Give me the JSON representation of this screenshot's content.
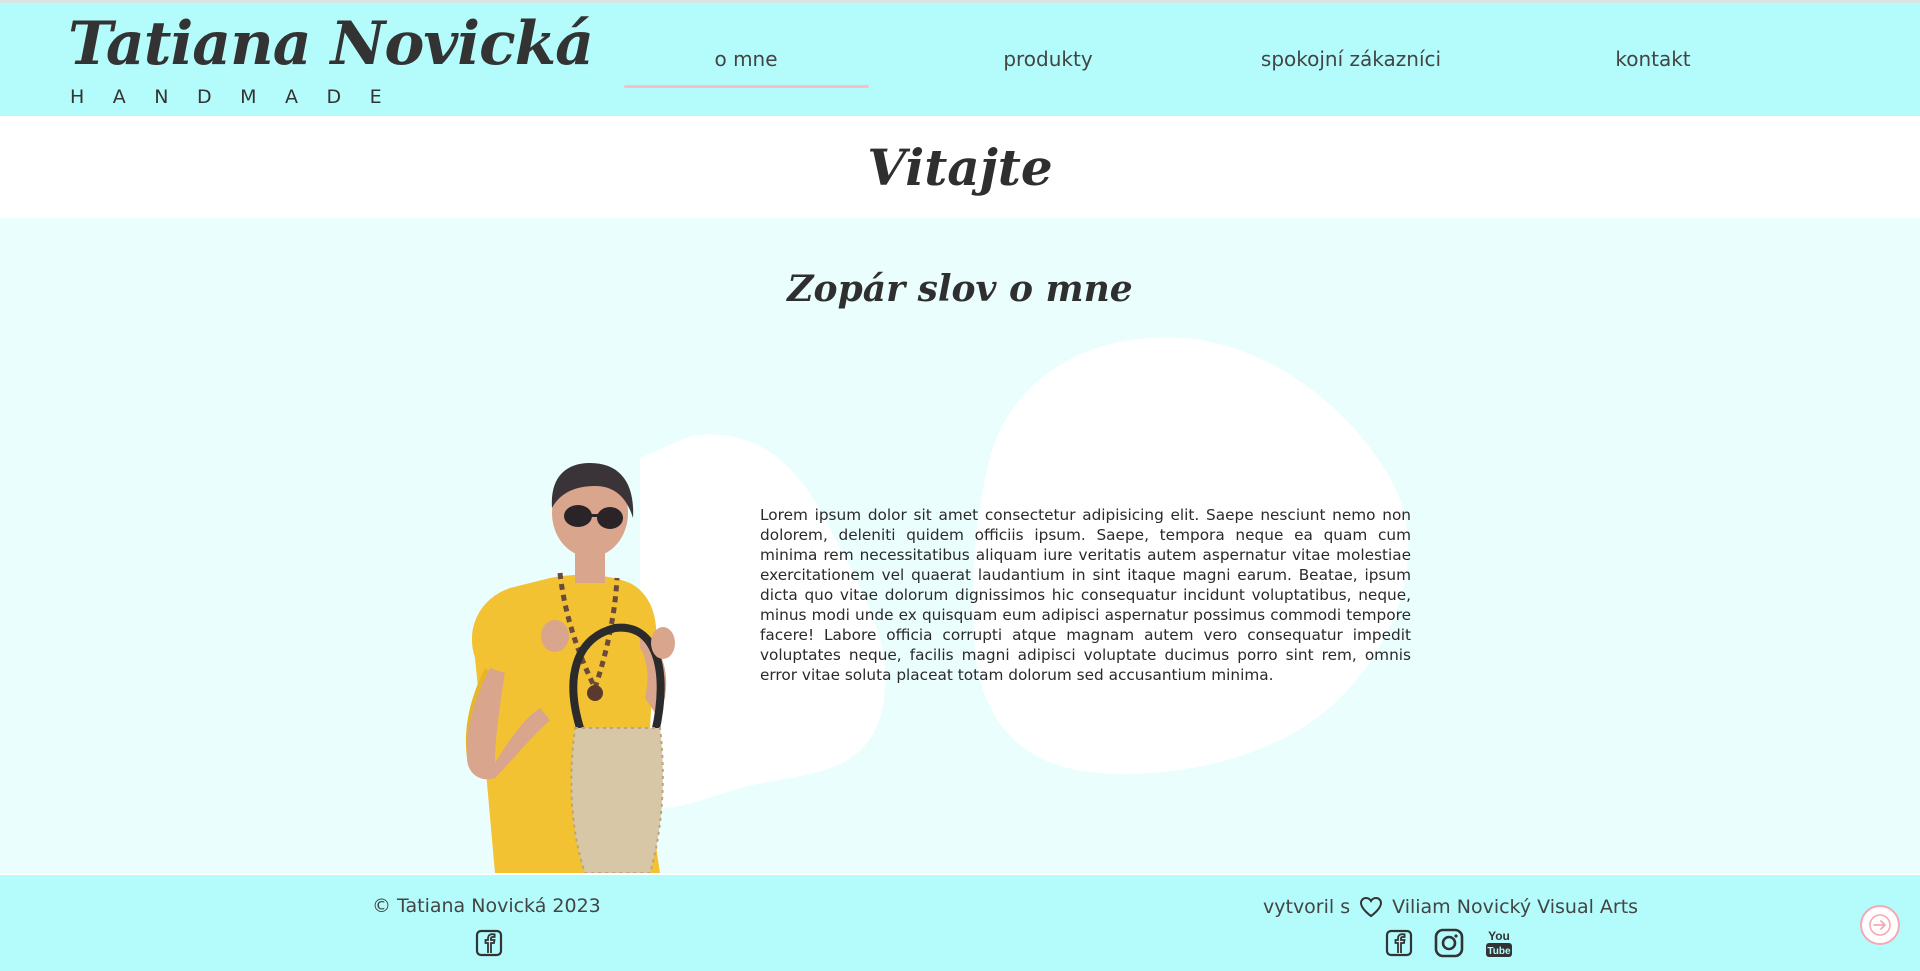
{
  "header": {
    "logo_name": "Tatiana Novická",
    "logo_sub": "HANDMADE",
    "nav": [
      {
        "label": "o mne",
        "active": true
      },
      {
        "label": "produkty"
      },
      {
        "label": "spokojní zákazníci"
      },
      {
        "label": "kontakt"
      }
    ]
  },
  "welcome": {
    "title": "Vitajte"
  },
  "about": {
    "title": "Zopár slov o mne",
    "text": "Lorem ipsum dolor sit amet consectetur adipisicing elit. Saepe nesciunt nemo non dolorem, deleniti quidem officiis ipsum. Saepe, tempora neque ea quam cum minima rem necessitatibus aliquam iure veritatis autem aspernatur vitae molestiae exercitationem vel quaerat laudantium in sint itaque magni earum. Beatae, ipsum dicta quo vitae dolorum dignissimos hic consequatur incidunt voluptatibus, neque, minus modi unde ex quisquam eum adipisci aspernatur possimus commodi tempore facere! Labore officia corrupti atque magnam autem vero consequatur impedit voluptates neque, facilis magni adipisci voluptate ducimus porro sint rem, omnis error vitae soluta placeat totam dolorum sed accusantium minima."
  },
  "footer": {
    "copyright": "© Tatiana Novická 2023",
    "credit_prefix": "vytvoril s",
    "credit_name": "Viliam Novický Visual Arts",
    "social_icons": [
      "facebook-icon",
      "instagram-icon",
      "youtube-icon"
    ]
  },
  "colors": {
    "header_bg": "#b4fcfc",
    "main_bg": "#ebfefe",
    "accent_underline": "#f6c0c6",
    "dress": "#f2c233"
  }
}
